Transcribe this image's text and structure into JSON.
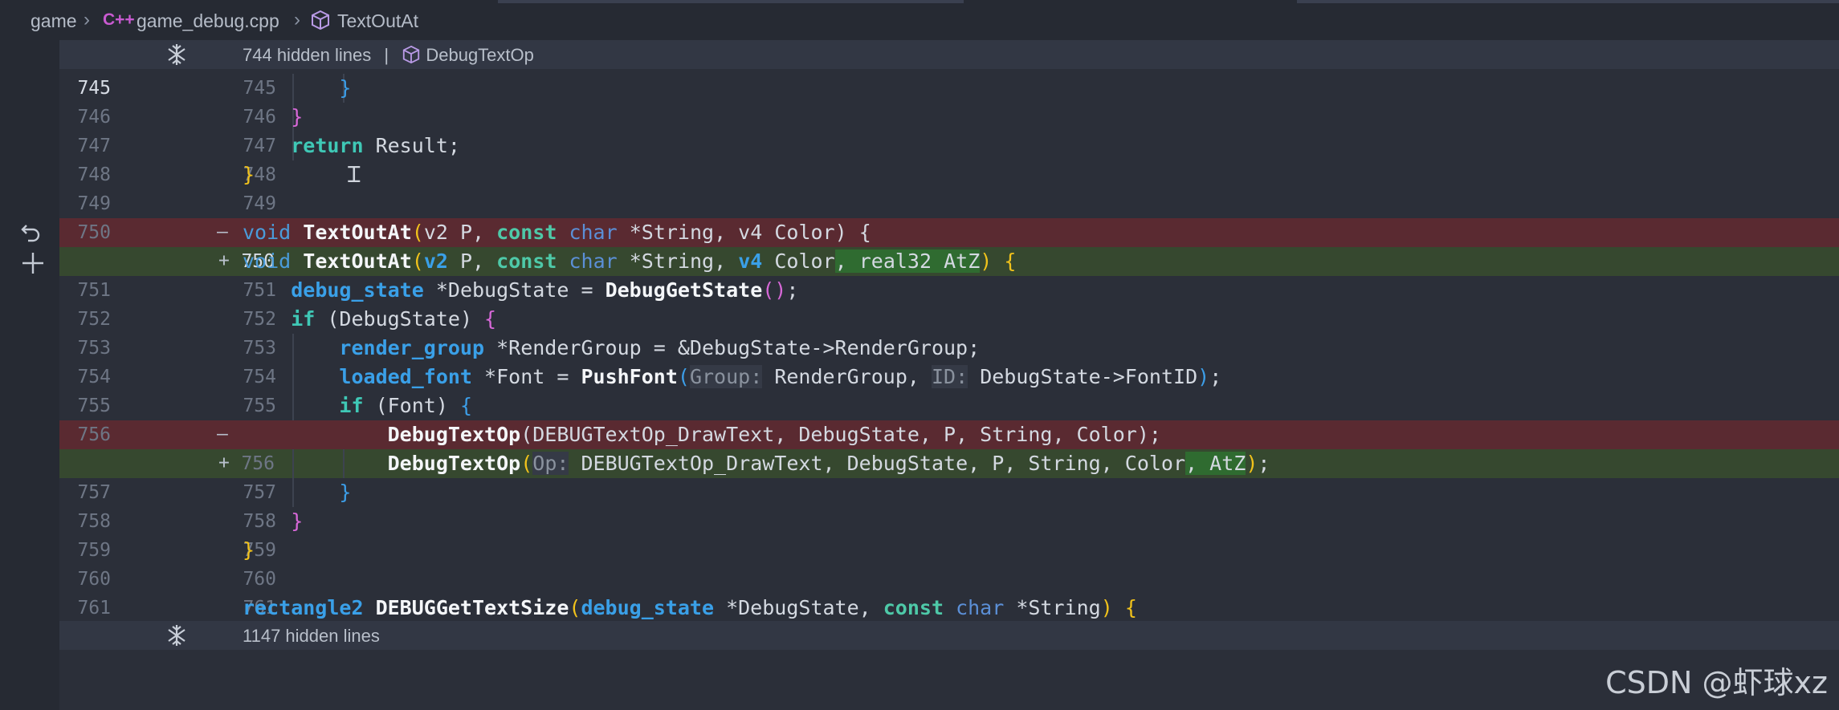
{
  "breadcrumb": {
    "folder": "game",
    "file_icon": "C++",
    "file": "game_debug.cpp",
    "symbol": "TextOutAt"
  },
  "hidden_top": {
    "text": "744 hidden lines",
    "separator": "|",
    "symbol": "DebugTextOp"
  },
  "hidden_bottom": {
    "text": "1147 hidden lines"
  },
  "lines": [
    {
      "a": "745",
      "b": "745",
      "marker": ""
    },
    {
      "a": "746",
      "b": "746",
      "marker": ""
    },
    {
      "a": "747",
      "b": "747",
      "marker": ""
    },
    {
      "a": "748",
      "b": "748",
      "marker": ""
    },
    {
      "a": "749",
      "b": "749",
      "marker": ""
    },
    {
      "a": "750",
      "b": "",
      "marker": "—"
    },
    {
      "a": "",
      "b": "750",
      "marker": "+"
    },
    {
      "a": "751",
      "b": "751",
      "marker": ""
    },
    {
      "a": "752",
      "b": "752",
      "marker": ""
    },
    {
      "a": "753",
      "b": "753",
      "marker": ""
    },
    {
      "a": "754",
      "b": "754",
      "marker": ""
    },
    {
      "a": "755",
      "b": "755",
      "marker": ""
    },
    {
      "a": "756",
      "b": "",
      "marker": "—"
    },
    {
      "a": "",
      "b": "756",
      "marker": "+"
    },
    {
      "a": "757",
      "b": "757",
      "marker": ""
    },
    {
      "a": "758",
      "b": "758",
      "marker": ""
    },
    {
      "a": "759",
      "b": "759",
      "marker": ""
    },
    {
      "a": "760",
      "b": "760",
      "marker": ""
    },
    {
      "a": "761",
      "b": "761",
      "marker": ""
    }
  ],
  "code": {
    "l745": "}",
    "l746": "}",
    "l747_kw": "return",
    "l747_rest": " Result;",
    "l748": "}",
    "l750_void": "void",
    "l750_fn": "TextOutAt",
    "l750_p1": "(",
    "l750_args": "v2 P, ",
    "l750_const": "const",
    "l750_char": "char",
    "l750_rest": " *String, v4 Color) {",
    "l750b_void": "void",
    "l750b_fn": "TextOutAt",
    "l750b_p1": "(",
    "l750b_v2": "v2",
    "l750b_P": " P, ",
    "l750b_const": "const",
    "l750b_char": "char",
    "l750b_str": " *String, ",
    "l750b_v4": "v4",
    "l750b_color": " Color",
    "l750b_added": ", real32 AtZ",
    "l750b_close": ")",
    "l750b_brace": " {",
    "l751_type": "debug_state",
    "l751_mid": " *DebugState = ",
    "l751_fn": "DebugGetState",
    "l751_paren": "()",
    "l751_end": ";",
    "l752_kw": "if",
    "l752_rest": " (DebugState) ",
    "l752_brace": "{",
    "l753_type": "render_group",
    "l753_rest": " *RenderGroup = &DebugState->RenderGroup;",
    "l754_type": "loaded_font",
    "l754_mid": " *Font = ",
    "l754_fn": "PushFont",
    "l754_p": "(",
    "l754_hint1": "Group:",
    "l754_arg1": " RenderGroup, ",
    "l754_hint2": "ID:",
    "l754_arg2": " DebugState->FontID",
    "l754_close": ")",
    "l754_end": ";",
    "l755_kw": "if",
    "l755_rest": " (Font) ",
    "l755_brace": "{",
    "l756_fn": "DebugTextOp",
    "l756_rest": "(DEBUGTextOp_DrawText, DebugState, P, String, Color);",
    "l756b_fn": "DebugTextOp",
    "l756b_p": "(",
    "l756b_hint": "Op:",
    "l756b_args": " DEBUGTextOp_DrawText, DebugState, P, String, Color",
    "l756b_added": ", AtZ",
    "l756b_close": ")",
    "l756b_end": ";",
    "l757": "}",
    "l758": "}",
    "l759": "}",
    "l761_type": "rectangle2",
    "l761_fn": " DEBUGGetTextSize",
    "l761_p": "(",
    "l761_type2": "debug_state",
    "l761_mid": " *DebugState, ",
    "l761_const": "const",
    "l761_char": " char",
    "l761_rest": " *String",
    "l761_close": ")",
    "l761_brace": " {"
  },
  "watermark": "CSDN @虾球xz",
  "colors": {
    "deleted": "#5a2a31",
    "added": "#36482f",
    "keyword": "#49d1c7",
    "type": "#3aa0e8"
  }
}
